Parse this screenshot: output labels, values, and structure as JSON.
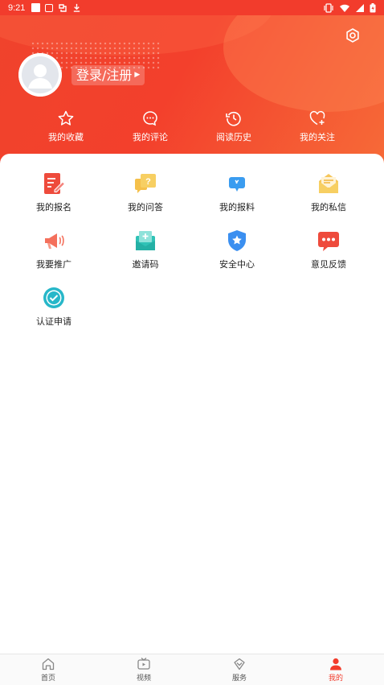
{
  "status_bar": {
    "time": "9:21"
  },
  "profile": {
    "login_label": "登录/注册"
  },
  "quick_links": [
    {
      "label": "我的收藏",
      "icon": "star-icon"
    },
    {
      "label": "我的评论",
      "icon": "comment-icon"
    },
    {
      "label": "阅读历史",
      "icon": "history-icon"
    },
    {
      "label": "我的关注",
      "icon": "heart-add-icon"
    }
  ],
  "grid": [
    {
      "label": "我的报名",
      "icon": "signup-form-icon"
    },
    {
      "label": "我的问答",
      "icon": "qa-icon"
    },
    {
      "label": "我的报料",
      "icon": "report-news-icon"
    },
    {
      "label": "我的私信",
      "icon": "private-message-icon"
    },
    {
      "label": "我要推广",
      "icon": "megaphone-icon"
    },
    {
      "label": "邀请码",
      "icon": "invite-code-icon"
    },
    {
      "label": "安全中心",
      "icon": "shield-icon"
    },
    {
      "label": "意见反馈",
      "icon": "feedback-icon"
    },
    {
      "label": "认证申请",
      "icon": "verified-badge-icon"
    }
  ],
  "tabs": [
    {
      "label": "首页",
      "icon": "home-icon"
    },
    {
      "label": "视频",
      "icon": "video-icon"
    },
    {
      "label": "服务",
      "icon": "service-icon"
    },
    {
      "label": "我的",
      "icon": "user-icon",
      "active": true
    }
  ],
  "colors": {
    "accent": "#f23c2c",
    "header_start": "#f0432c",
    "header_end": "#f76b38"
  }
}
